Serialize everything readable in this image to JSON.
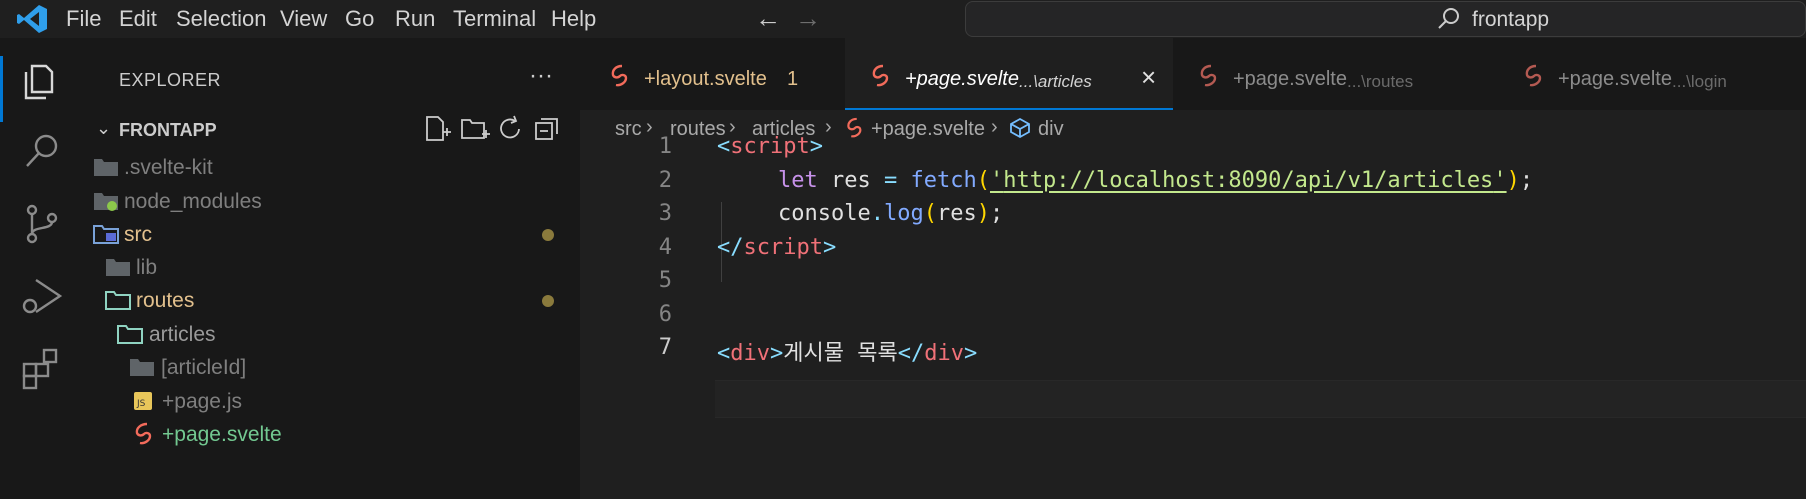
{
  "menu": {
    "items": [
      "File",
      "Edit",
      "Selection",
      "View",
      "Go",
      "Run",
      "Terminal",
      "Help"
    ]
  },
  "command_center": {
    "label": "frontapp",
    "icon": "search-icon"
  },
  "activity_bar": {
    "items": [
      "explorer-icon",
      "search-icon",
      "source-control-icon",
      "run-debug-icon",
      "extensions-icon"
    ]
  },
  "explorer": {
    "title": "EXPLORER",
    "more": "···",
    "workspace": "FRONTAPP",
    "tree": [
      {
        "label": ".svelte-kit",
        "type": "folder",
        "depth": 0,
        "color": "#7f7f7f"
      },
      {
        "label": "node_modules",
        "type": "folder",
        "depth": 0,
        "color": "#7f7f7f"
      },
      {
        "label": "src",
        "type": "folder",
        "depth": 0,
        "color": "#e2c08d",
        "modified": true
      },
      {
        "label": "lib",
        "type": "folder",
        "depth": 1,
        "color": "#7f7f7f"
      },
      {
        "label": "routes",
        "type": "folder",
        "depth": 1,
        "color": "#e2c08d",
        "modified": true
      },
      {
        "label": "articles",
        "type": "folder",
        "depth": 2,
        "color": "#9a9a9a"
      },
      {
        "label": "[articleId]",
        "type": "folder",
        "depth": 3,
        "color": "#7f7f7f"
      },
      {
        "label": "+page.js",
        "type": "file-js",
        "depth": 3,
        "color": "#7f7f7f"
      },
      {
        "label": "+page.svelte",
        "type": "file-svelte",
        "depth": 3,
        "color": "#73c991"
      }
    ]
  },
  "tabs": [
    {
      "label": "+layout.svelte",
      "badge": "1",
      "desc": ""
    },
    {
      "label": "+page.svelte",
      "desc": "...\\articles",
      "active": true
    },
    {
      "label": "+page.svelte",
      "desc": "...\\routes"
    },
    {
      "label": "+page.svelte",
      "desc": "...\\login"
    }
  ],
  "breadcrumbs": [
    "src",
    "routes",
    "articles",
    "+page.svelte",
    "div"
  ],
  "code": {
    "line_numbers": [
      "1",
      "2",
      "3",
      "4",
      "5",
      "6",
      "7"
    ],
    "line1": {
      "open": "<",
      "tag": "script",
      "close": ">"
    },
    "line2": {
      "kw": "let",
      "var": "res",
      "op": "=",
      "fn": "fetch",
      "lparen": "(",
      "q1": "'",
      "url": "http://localhost:8090/api/v1/articles",
      "q2": "'",
      "rparen": ")",
      "semi": ";"
    },
    "line3": {
      "obj": "console",
      "dot": ".",
      "method": "log",
      "lparen": "(",
      "arg": "res",
      "rparen": ")",
      "semi": ";"
    },
    "line4": {
      "open": "</",
      "tag": "script",
      "close": ">"
    },
    "line7": {
      "open": "<",
      "tag": "div",
      "close": ">",
      "text": "게시물 목록",
      "open2": "</",
      "tag2": "div",
      "close2": ">"
    }
  },
  "colors": {
    "accent": "#0078d4",
    "svelte": "#f26b5b",
    "modified": "#e2c08d",
    "added": "#73c991"
  }
}
